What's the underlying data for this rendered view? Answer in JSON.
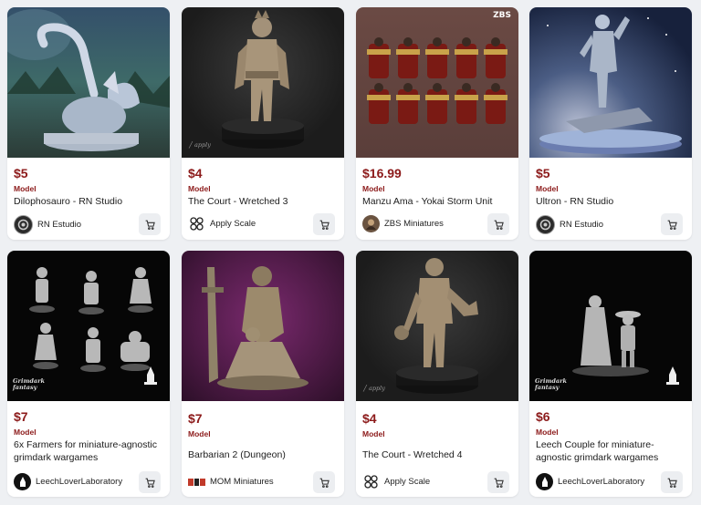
{
  "colors": {
    "price": "#8c1a1a",
    "background": "#eef0f3",
    "card": "#ffffff"
  },
  "products": [
    {
      "price": "$5",
      "type": "Model",
      "title": "Dilophosauro - RN Studio",
      "seller": "RN Estudio",
      "seller_icon": "rn-logo-icon",
      "cart_icon": "cart-icon"
    },
    {
      "price": "$4",
      "type": "Model",
      "title": "The Court - Wretched 3",
      "seller": "Apply Scale",
      "seller_icon": "apply-scale-logo-icon",
      "cart_icon": "cart-icon"
    },
    {
      "price": "$16.99",
      "type": "Model",
      "title": "Manzu Ama - Yokai Storm Unit",
      "seller": "ZBS Miniatures",
      "seller_icon": "zbs-logo-icon",
      "cart_icon": "cart-icon",
      "badge": "ZBS"
    },
    {
      "price": "$5",
      "type": "Model",
      "title": "Ultron - RN Studio",
      "seller": "RN Estudio",
      "seller_icon": "rn-logo-icon",
      "cart_icon": "cart-icon"
    },
    {
      "price": "$7",
      "type": "Model",
      "title": "6x Farmers for miniature-agnostic grimdark wargames",
      "seller": "LeechLoverLaboratory",
      "seller_icon": "leech-lover-logo-icon",
      "cart_icon": "cart-icon"
    },
    {
      "price": "$7",
      "type": "Model",
      "title": "Barbarian 2 (Dungeon)",
      "seller": "MOM Miniatures",
      "seller_icon": "mom-logo-icon",
      "cart_icon": "cart-icon"
    },
    {
      "price": "$4",
      "type": "Model",
      "title": "The Court - Wretched 4",
      "seller": "Apply Scale",
      "seller_icon": "apply-scale-logo-icon",
      "cart_icon": "cart-icon"
    },
    {
      "price": "$6",
      "type": "Model",
      "title": "Leech Couple for miniature-agnostic grimdark wargames",
      "seller": "LeechLoverLaboratory",
      "seller_icon": "leech-lover-logo-icon",
      "cart_icon": "cart-icon"
    }
  ]
}
